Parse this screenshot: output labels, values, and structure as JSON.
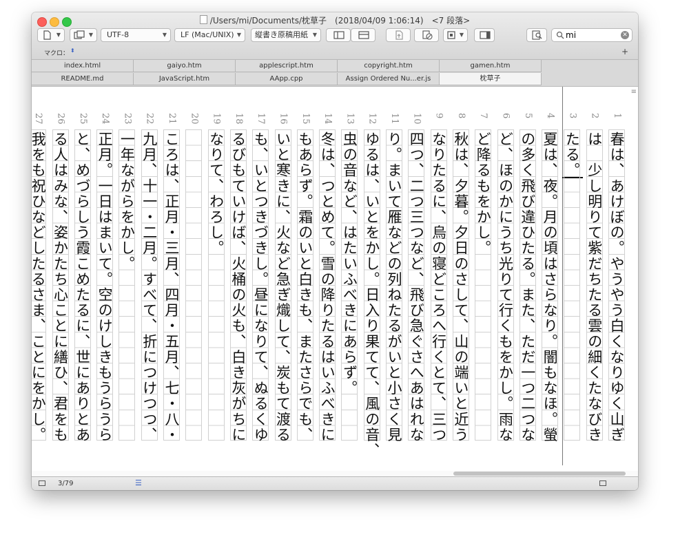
{
  "window": {
    "title": "/Users/mi/Documents/枕草子　(2018/04/09 1:06:14)　<7 段落>"
  },
  "toolbar": {
    "encoding": "UTF-8",
    "line_ending": "LF (Mac/UNIX)",
    "paper_mode": "縦書き原稿用紙",
    "search_value": "mi",
    "macro_label": "マクロ："
  },
  "tabs_row1": [
    "index.html",
    "gaiyo.htm",
    "applescript.htm",
    "copyright.htm",
    "gamen.htm"
  ],
  "tabs_row2": [
    "README.md",
    "JavaScript.htm",
    "AApp.cpp",
    "Assign Ordered Nu...er.js",
    "枕草子"
  ],
  "active_tab": "枕草子",
  "lines": [
    {
      "num": "1",
      "text": "春は、あけぼの。やうやう白くなりゆく山ぎ"
    },
    {
      "num": "2",
      "text": "は　少し明りて紫だちたる雲の細くたなびき"
    },
    {
      "num": "3",
      "text": "たる。"
    },
    {
      "num": "4",
      "text": "夏は、夜。月の頃はさらなり。闇もなほ。螢"
    },
    {
      "num": "5",
      "text": "の多く飛び違ひたる。また、ただ一つ二つな"
    },
    {
      "num": "6",
      "text": "ど、ほのかにうち光りて行くもをかし。雨な"
    },
    {
      "num": "7",
      "text": "ど降るもをかし。"
    },
    {
      "num": "8",
      "text": "秋は、夕暮。夕日のさして、山の端いと近う"
    },
    {
      "num": "9",
      "text": "なりたるに、烏の寝どころへ行くとて、三つ"
    },
    {
      "num": "10",
      "text": "四つ、二つ三つなど、飛び急ぐさへあはれな"
    },
    {
      "num": "11",
      "text": "り。まいて雁などの列ねたるがいと小さく見"
    },
    {
      "num": "12",
      "text": "ゆるは、いとをかし。日入り果てて、風の音、"
    },
    {
      "num": "13",
      "text": "虫の音など、はたいふべきにあらず。"
    },
    {
      "num": "14",
      "text": "冬は、つとめて。雪の降りたるはいふべきに"
    },
    {
      "num": "15",
      "text": "もあらず。霜のいと白きも、またさらでも、"
    },
    {
      "num": "16",
      "text": "いと寒きに、火など急ぎ熾して、炭もて渡る"
    },
    {
      "num": "17",
      "text": "も、いとつきづきし。昼になりて、ぬるくゆ"
    },
    {
      "num": "18",
      "text": "るびもていけば、火桶の火も、白き灰がちに"
    },
    {
      "num": "19",
      "text": "なりて、わろし。"
    },
    {
      "num": "20",
      "text": ""
    },
    {
      "num": "21",
      "text": "ころは、正月・三月、四月・五月、七・八・"
    },
    {
      "num": "22",
      "text": "九月、十一・二月。すべて、折につけつつ、"
    },
    {
      "num": "23",
      "text": "一年ながらをかし。"
    },
    {
      "num": "24",
      "text": "正月。一日はまいて。空のけしきもうらうら"
    },
    {
      "num": "25",
      "text": "と、めづらしう霞こめたるに、世にありとあ"
    },
    {
      "num": "26",
      "text": "る人はみな、姿かたち心ことに繕ひ、君をも"
    },
    {
      "num": "27",
      "text": "我をも祝ひなどしたるさま、ことにをかし。"
    }
  ],
  "status": {
    "position": "3/79"
  }
}
